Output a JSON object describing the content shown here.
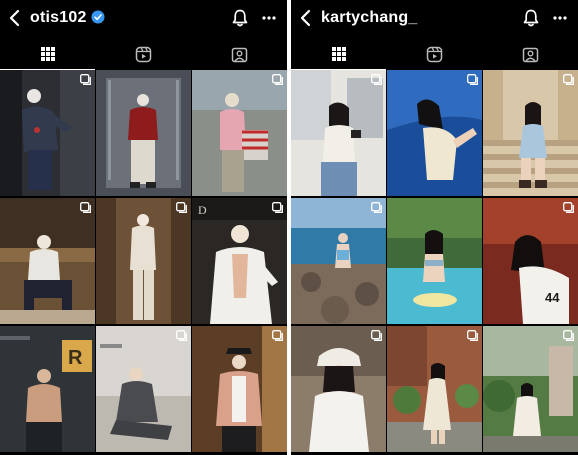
{
  "colors": {
    "background": "#000000",
    "text": "#ffffff",
    "verified": "#3897f0"
  },
  "left": {
    "username": "otis102",
    "verified": true
  },
  "right": {
    "username": "kartychang_",
    "verified": false
  },
  "tabs": [
    {
      "icon": "grid-icon",
      "active": true
    },
    {
      "icon": "reels-icon",
      "active": false
    },
    {
      "icon": "tagged-icon",
      "active": false
    }
  ]
}
